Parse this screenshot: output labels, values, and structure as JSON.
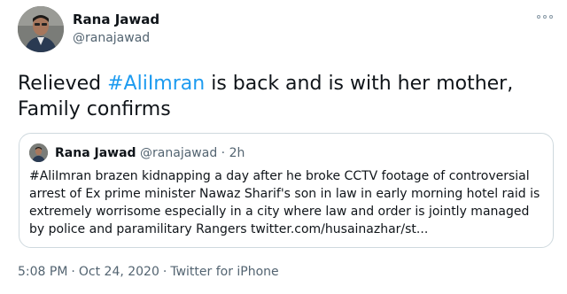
{
  "author": {
    "name": "Rana Jawad",
    "handle": "@ranajawad"
  },
  "tweet": {
    "text_before": "Relieved ",
    "hashtag": "#AliImran",
    "text_after": " is back and is with her mother, Family confirms"
  },
  "quoted": {
    "name": "Rana Jawad",
    "handle": "@ranajawad",
    "separator": "·",
    "time": "2h",
    "text": "#AliImran brazen kidnapping a day after he broke CCTV footage of controversial arrest of Ex prime minister Nawaz Sharif's son in law in early morning hotel raid is extremely worrisome especially in a city where law and order is jointly managed by police and paramilitary Rangers twitter.com/husainazhar/st..."
  },
  "footer": {
    "time": "5:08 PM",
    "separator": "·",
    "date": "Oct 24, 2020",
    "source": "Twitter for iPhone"
  },
  "icons": {
    "more": "more-options-icon"
  },
  "colors": {
    "link": "#1d9bf0",
    "secondary_text": "#536471",
    "border": "#cfd9de"
  }
}
